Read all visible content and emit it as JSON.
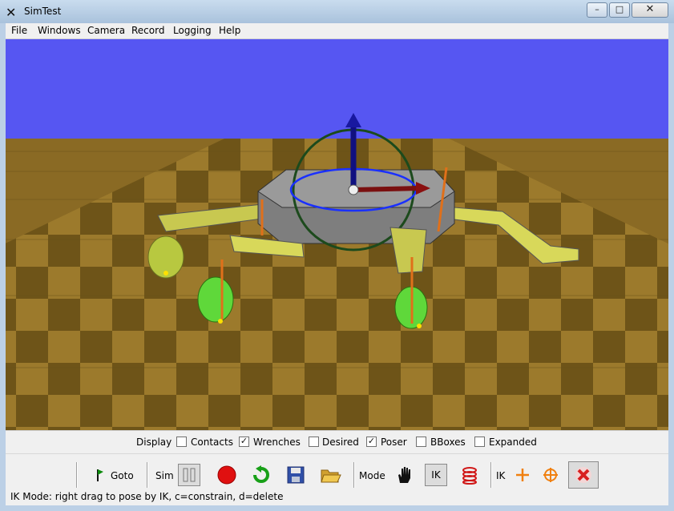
{
  "window": {
    "title": "SimTest",
    "min_label": "–",
    "max_label": "□",
    "close_label": "✕"
  },
  "menubar": {
    "items": [
      "File",
      "Windows",
      "Camera",
      "Record",
      "Logging",
      "Help"
    ]
  },
  "display": {
    "label": "Display",
    "options": [
      {
        "label": "Contacts",
        "checked": false
      },
      {
        "label": "Wrenches",
        "checked": true
      },
      {
        "label": "Desired",
        "checked": false
      },
      {
        "label": "Poser",
        "checked": true
      },
      {
        "label": "BBoxes",
        "checked": false
      },
      {
        "label": "Expanded",
        "checked": false
      }
    ]
  },
  "toolbar": {
    "goto_label": "Goto",
    "sim_label": "Sim",
    "mode_label": "Mode",
    "ik_button_label": "IK",
    "ik_label": "IK",
    "icons": [
      "flag-icon",
      "pause-icon",
      "record-icon",
      "reset-icon",
      "save-icon",
      "open-folder-icon",
      "hand-icon",
      "spring-icon",
      "plus-icon",
      "target-icon",
      "delete-icon"
    ]
  },
  "status": {
    "text": "IK Mode: right drag to pose by IK, c=constrain, d=delete"
  },
  "colors": {
    "sky": "#5656f2",
    "floor_light": "#9c7a2c",
    "floor_dark": "#6e5418",
    "robot_body": "#8e8e8e",
    "leg": "#d8d85a",
    "wheel": "#5fd83a",
    "arrow": "#e0701a"
  }
}
